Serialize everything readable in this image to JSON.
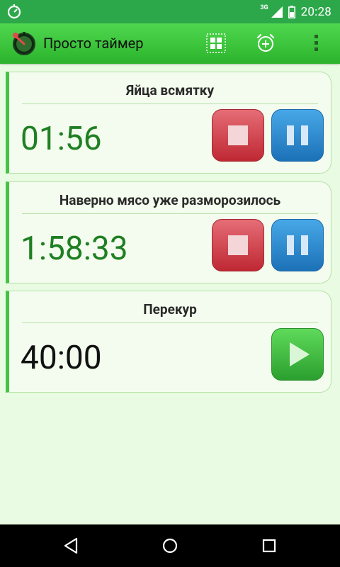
{
  "status_bar": {
    "time": "20:28",
    "network": "3G",
    "icons": [
      "timer-app-icon",
      "signal-icon",
      "battery-icon"
    ]
  },
  "app_bar": {
    "title": "Просто таймер",
    "actions": [
      "grid-icon",
      "add-alarm-icon",
      "more-vert-icon"
    ]
  },
  "timers": [
    {
      "title": "Яйца всмятку",
      "value": "01:56",
      "state": "running"
    },
    {
      "title": "Наверно мясо уже разморозилось",
      "value": "1:58:33",
      "state": "running"
    },
    {
      "title": "Перекур",
      "value": "40:00",
      "state": "stopped"
    }
  ],
  "colors": {
    "status_bar": "#2ca84a",
    "app_bar": "#37c23b",
    "background": "#e9fbe3",
    "accent_green": "#45c245",
    "running_time": "#1f7f23",
    "stop_button": "#d0434d",
    "pause_button": "#2c8ed5",
    "play_button": "#43c043"
  },
  "nav_bar": {
    "icons": [
      "back-icon",
      "home-icon",
      "recents-icon"
    ]
  }
}
